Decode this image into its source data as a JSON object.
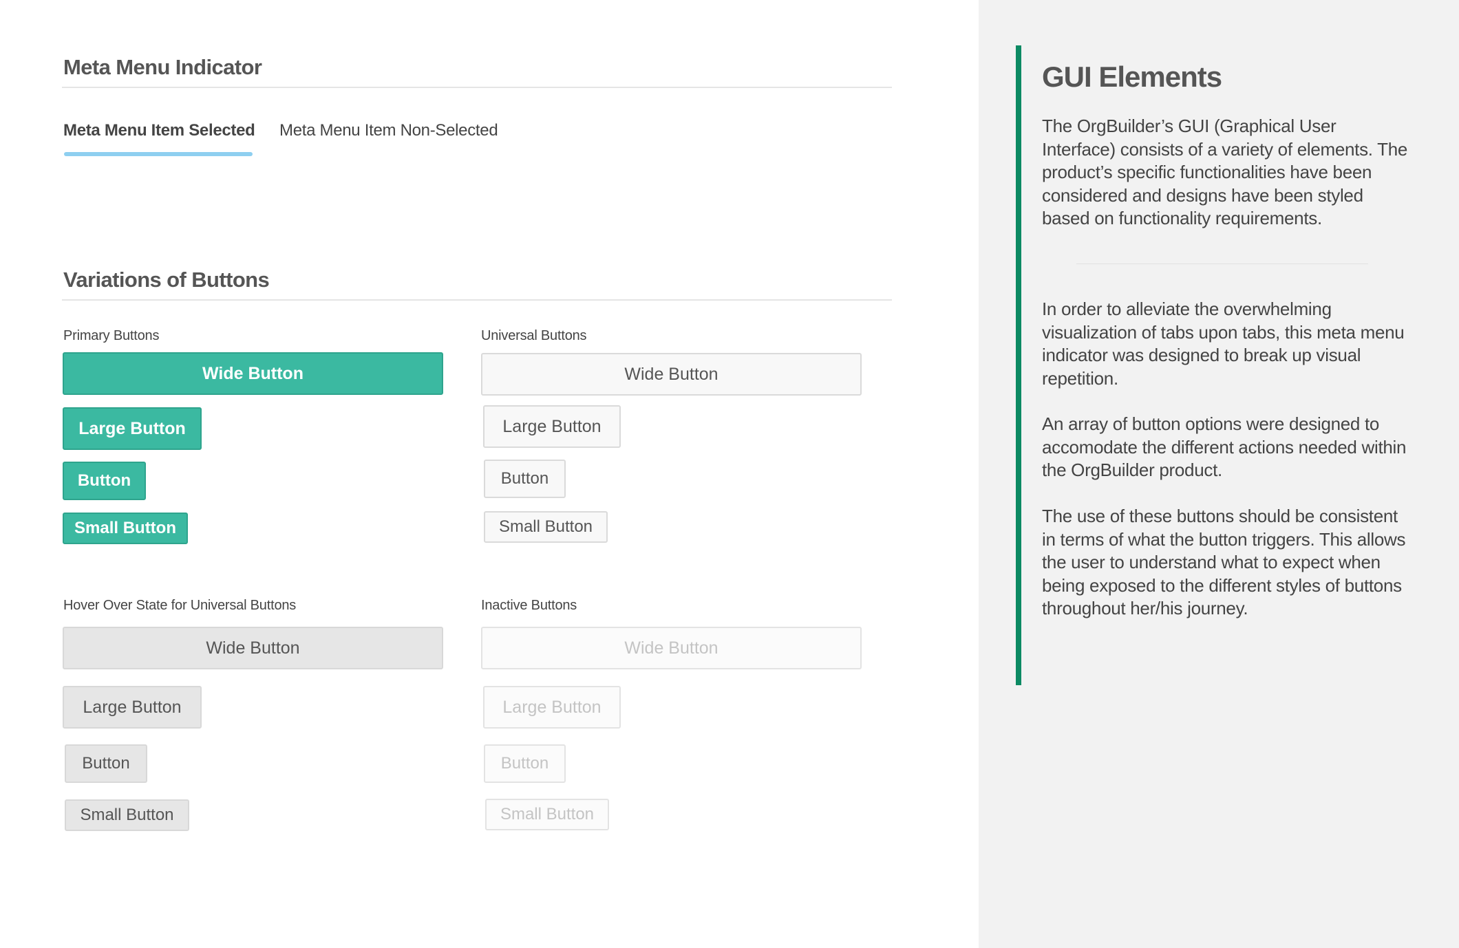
{
  "meta_menu": {
    "title": "Meta Menu Indicator",
    "selected_item": "Meta Menu Item Selected",
    "nonselected_item": "Meta Menu Item Non-Selected",
    "indicator_color": "#8ecff0"
  },
  "buttons_section": {
    "title": "Variations of Buttons",
    "primary": {
      "label": "Primary Buttons",
      "color": "#3bb9a1",
      "wide": "Wide Button",
      "large": "Large Button",
      "normal": "Button",
      "small": "Small Button"
    },
    "universal": {
      "label": "Universal Buttons",
      "wide": "Wide Button",
      "large": "Large Button",
      "normal": "Button",
      "small": "Small Button"
    },
    "hover": {
      "label": "Hover Over State for Universal Buttons",
      "wide": "Wide Button",
      "large": "Large Button",
      "normal": "Button",
      "small": "Small Button"
    },
    "inactive": {
      "label": "Inactive Buttons",
      "wide": "Wide Button",
      "large": "Large Button",
      "normal": "Button",
      "small": "Small Button"
    }
  },
  "sidebar": {
    "title": "GUI Elements",
    "accent_color": "#0c8a63",
    "para1": "The OrgBuilder’s GUI (Graphical User Interface) consists of a variety of elements. The product’s specific functionalities have been considered and designs have been styled based on functionality requirements.",
    "para2": "In order to alleviate the overwhelming visualization of tabs upon tabs, this meta menu indicator was designed to break up visual repetition.",
    "para3": "An array of button options were designed to accomodate the different actions needed within the OrgBuilder product.",
    "para4": "The use of these buttons should be consistent in terms of what the button triggers. This allows the user to understand what to expect when being exposed to the different styles of buttons throughout her/his journey."
  }
}
